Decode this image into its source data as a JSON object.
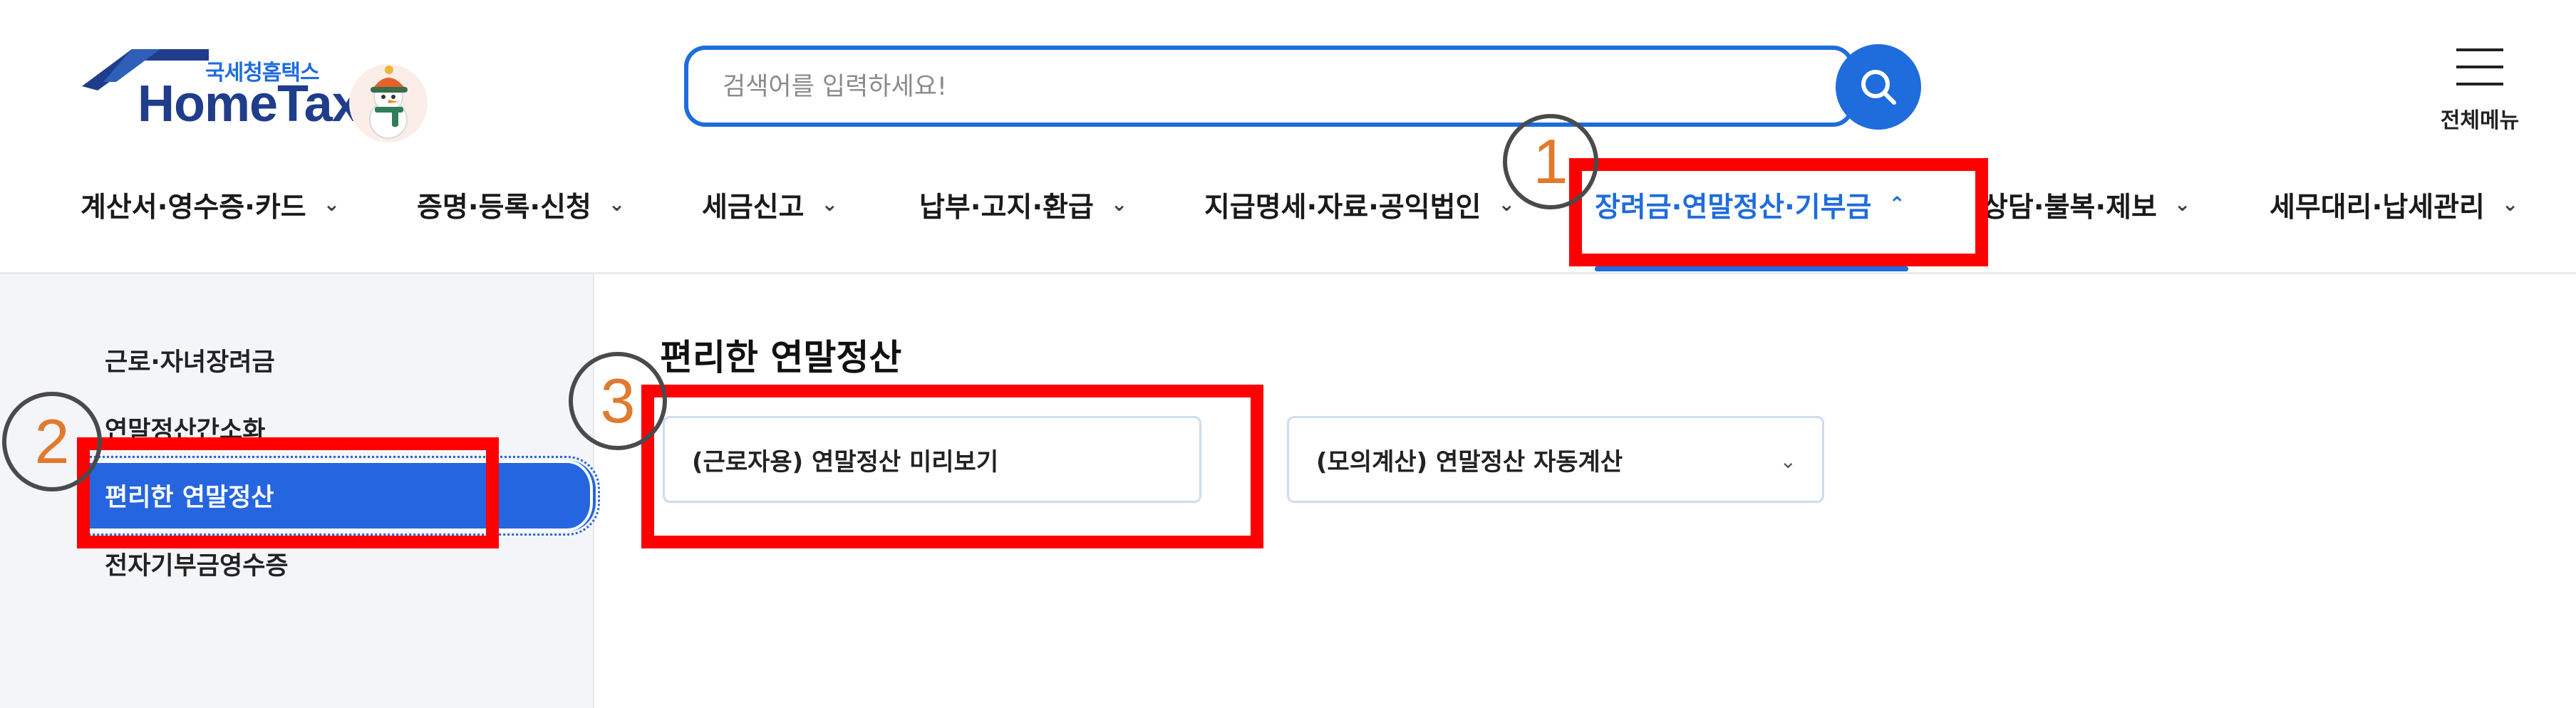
{
  "header": {
    "brand_tagline": "국세청홈택스",
    "brand_name": "HomeTax",
    "search_placeholder": "검색어를 입력하세요!",
    "all_menu_label": "전체메뉴"
  },
  "gnb": {
    "items": [
      {
        "label": "계산서·영수증·카드",
        "chevron": "⌄"
      },
      {
        "label": "증명·등록·신청",
        "chevron": "⌄"
      },
      {
        "label": "세금신고",
        "chevron": "⌄"
      },
      {
        "label": "납부·고지·환급",
        "chevron": "⌄"
      },
      {
        "label": "지급명세·자료·공익법인",
        "chevron": "⌄"
      },
      {
        "label": "장려금·연말정산·기부금",
        "chevron": "⌃",
        "active": true
      },
      {
        "label": "상담·불복·제보",
        "chevron": "⌄"
      },
      {
        "label": "세무대리·납세관리",
        "chevron": "⌄"
      }
    ]
  },
  "sidebar": {
    "items": [
      {
        "label": "근로·자녀장려금"
      },
      {
        "label": "연말정산간소화"
      },
      {
        "label": "편리한 연말정산",
        "active": true
      },
      {
        "label": "전자기부금영수증"
      }
    ]
  },
  "main": {
    "title": "편리한 연말정산",
    "cards": [
      {
        "label": "(근로자용) 연말정산 미리보기"
      },
      {
        "label": "(모의계산) 연말정산 자동계산",
        "chevron": "⌄"
      }
    ]
  },
  "annotations": {
    "step_1": "1",
    "step_2": "2",
    "step_3": "3",
    "highlight_color": "#ff0000",
    "number_color": "#e07a2e"
  },
  "colors": {
    "accent": "#1f6cdc",
    "sidebar_active": "#2565e0",
    "brand_navy": "#1f3d8a"
  }
}
